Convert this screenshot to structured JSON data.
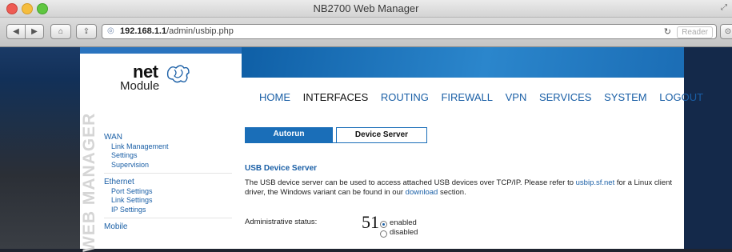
{
  "window": {
    "title": "NB2700 Web Manager"
  },
  "browser": {
    "url_host": "192.168.1.1",
    "url_path": "/admin/usbip.php",
    "reader_label": "Reader"
  },
  "logo": {
    "brand_top": "net",
    "brand_bottom": "Module"
  },
  "nav": [
    "HOME",
    "INTERFACES",
    "ROUTING",
    "FIREWALL",
    "VPN",
    "SERVICES",
    "SYSTEM",
    "LOGOUT"
  ],
  "nav_active": "INTERFACES",
  "side_watermark": "WEB MANAGER",
  "sidebar": {
    "groups": [
      {
        "title": "WAN",
        "items": [
          "Link Management",
          "Settings",
          "Supervision"
        ]
      },
      {
        "title": "Ethernet",
        "items": [
          "Port Settings",
          "Link Settings",
          "IP Settings"
        ]
      },
      {
        "title": "Mobile",
        "items": []
      }
    ]
  },
  "tabs": {
    "autorun": "Autorun",
    "device_server": "Device Server"
  },
  "section": {
    "title": "USB Device Server",
    "desc_part1": "The USB device server can be used to access attached USB devices over TCP/IP. Please refer to ",
    "desc_link1": "usbip.sf.net",
    "desc_part2": " for a Linux client driver, the Windows variant can be found in our ",
    "desc_link2": "download",
    "desc_part3": " section."
  },
  "admin": {
    "label": "Administrative status:",
    "marker": "51",
    "options": [
      "enabled",
      "disabled"
    ],
    "selected": "enabled"
  },
  "colors": {
    "accent": "#1a5fa6",
    "band": "#1a6eb8"
  }
}
